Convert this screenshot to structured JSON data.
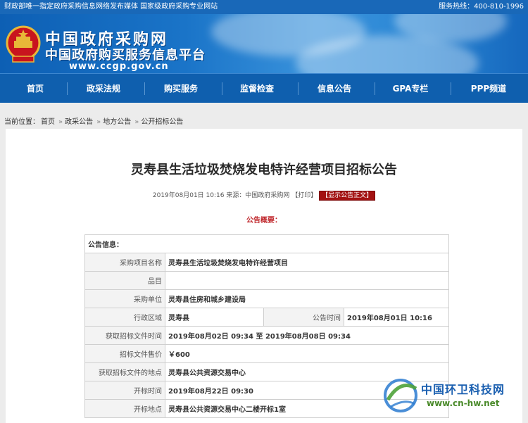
{
  "topbar": {
    "notice": "财政部唯一指定政府采购信息网络发布媒体 国家级政府采购专业网站",
    "hotline": "服务热线：400-810-1996"
  },
  "banner": {
    "title": "中国政府采购网",
    "subtitle": "中国政府购买服务信息平台",
    "url": "www.ccgp.gov.cn"
  },
  "nav": {
    "items": [
      "首页",
      "政采法规",
      "购买服务",
      "监督检查",
      "信息公告",
      "GPA专栏",
      "PPP频道"
    ]
  },
  "breadcrumb": {
    "prefix": "当前位置：",
    "items": [
      "首页",
      "政采公告",
      "地方公告",
      "公开招标公告"
    ]
  },
  "article": {
    "title": "灵寿县生活垃圾焚烧发电特许经营项目招标公告",
    "meta_time_source": "2019年08月01日 10:16 来源：中国政府采购网",
    "print_label": "【打印】",
    "show_label": "【显示公告正文】",
    "summary_label": "公告概要："
  },
  "info_table": {
    "header": "公告信息：",
    "project_name_label": "采购项目名称",
    "project_name": "灵寿县生活垃圾焚烧发电特许经营项目",
    "item_label": "品目",
    "item": "",
    "buyer_label": "采购单位",
    "buyer": "灵寿县住房和城乡建设局",
    "region_label": "行政区域",
    "region": "灵寿县",
    "pub_time_label": "公告时间",
    "pub_time": "2019年08月01日 10:16",
    "obtain_time_label": "获取招标文件时间",
    "obtain_time": "2019年08月02日 09:34 至 2019年08月08日 09:34",
    "price_label": "招标文件售价",
    "price": "￥600",
    "obtain_place_label": "获取招标文件的地点",
    "obtain_place": "灵寿县公共资源交易中心",
    "open_time_label": "开标时间",
    "open_time": "2019年08月22日 09:30",
    "open_place_label": "开标地点",
    "open_place": "灵寿县公共资源交易中心二楼开标1室"
  },
  "watermark": {
    "name": "中国环卫科技网",
    "url": "www.cn-hw.net"
  }
}
